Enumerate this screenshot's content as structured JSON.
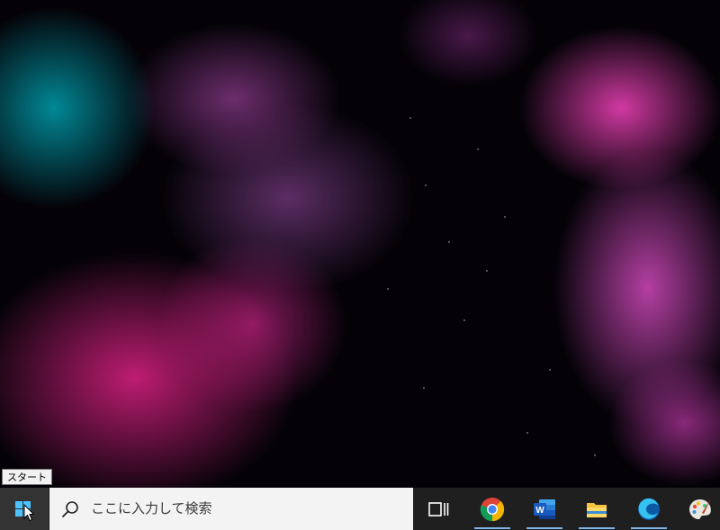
{
  "tooltip": {
    "text": "スタート"
  },
  "taskbar": {
    "search": {
      "placeholder": "ここに入力して検索"
    },
    "items": [
      {
        "name": "task-view",
        "running": false
      },
      {
        "name": "chrome",
        "running": true
      },
      {
        "name": "word",
        "running": true
      },
      {
        "name": "file-explorer",
        "running": true
      },
      {
        "name": "edge",
        "running": true
      },
      {
        "name": "paint",
        "running": false
      }
    ]
  },
  "colors": {
    "taskbar": "#1f1f1f",
    "search_box": "#f3f3f3",
    "windows_logo": "#4cc2ff",
    "running_indicator": "#7fb3e6"
  }
}
